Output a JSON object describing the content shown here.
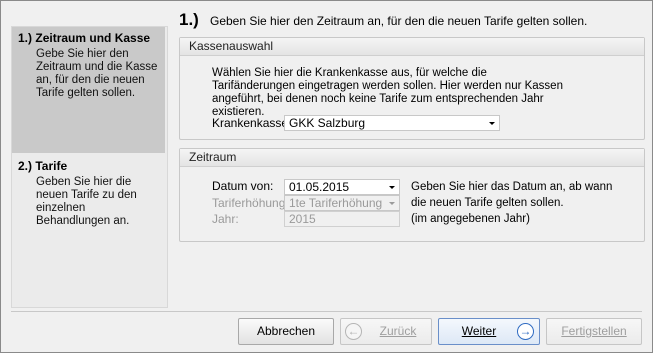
{
  "steps": [
    {
      "num": "1.)",
      "title": "Zeitraum und Kasse",
      "desc": "Gebe Sie hier den Zeitraum und die Kasse an, für den die neuen Tarife gelten sollen."
    },
    {
      "num": "2.)",
      "title": "Tarife",
      "desc": "Geben Sie hier die neuen Tarife zu den einzelnen Behandlungen an."
    }
  ],
  "header": {
    "num": "1.)",
    "text": "Geben Sie hier den Zeitraum an, für den die neuen Tarife gelten sollen."
  },
  "kassenauswahl": {
    "title": "Kassenauswahl",
    "text": "Wählen Sie hier die Krankenkasse aus, für welche die Tarifänderungen eingetragen werden sollen. Hier werden nur Kassen angeführt, bei denen noch keine Tarife zum entsprechenden Jahr existieren.",
    "label": "Krankenkasse:",
    "value": "GKK Salzburg"
  },
  "zeitraum": {
    "title": "Zeitraum",
    "datum_label": "Datum von:",
    "datum_value": "01.05.2015",
    "tarif_label": "Tariferhöhung:",
    "tarif_value": "1te Tariferhöhung",
    "jahr_label": "Jahr:",
    "jahr_value": "2015",
    "hint_line1": "Geben Sie hier das Datum an, ab wann",
    "hint_line2": "die neuen Tarife gelten sollen.",
    "hint_line3": "(im angegebenen Jahr)"
  },
  "buttons": {
    "cancel": "Abbrechen",
    "back": "Zurück",
    "next": "Weiter",
    "finish": "Fertigstellen"
  },
  "icons": {
    "back": "arrow-left-circle",
    "next": "arrow-right-circle",
    "dropdown": "chevron-down"
  },
  "colors": {
    "active_step": "#c9c9c9",
    "primary_border": "#6a8fc9",
    "next_icon": "#2f6bc2"
  }
}
